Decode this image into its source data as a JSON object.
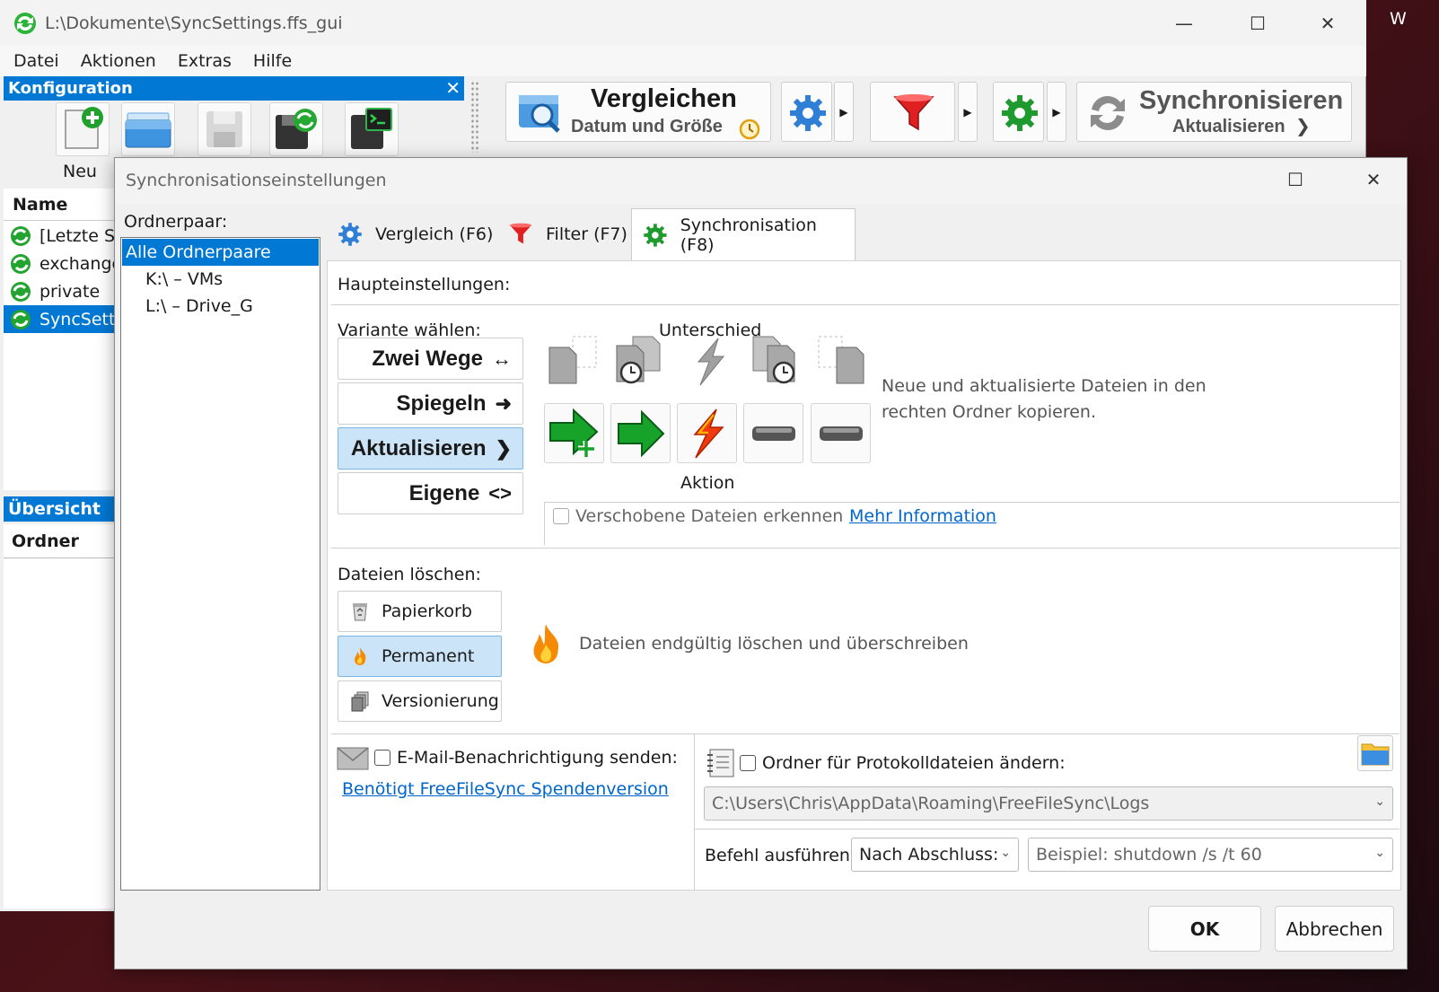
{
  "main_window": {
    "title": "L:\\Dokumente\\SyncSettings.ffs_gui",
    "menu": [
      "Datei",
      "Aktionen",
      "Extras",
      "Hilfe"
    ],
    "config_panel": {
      "header": "Konfiguration",
      "new_label": "Neu"
    },
    "toolbar": {
      "compare_title": "Vergleichen",
      "compare_sub": "Datum und Größe",
      "sync_title": "Synchronisieren",
      "sync_sub": "Aktualisieren"
    },
    "list_header": "Name",
    "list_items": [
      "[Letzte Si",
      "exchange",
      "private",
      "SyncSetti"
    ],
    "overview_header": "Übersicht",
    "folder_header": "Ordner",
    "edge_text": "W"
  },
  "dialog": {
    "title": "Synchronisationseinstellungen",
    "folder_pair_label": "Ordnerpaar:",
    "folder_pairs": [
      "Alle Ordnerpaare",
      "K:\\ – VMs",
      "L:\\ – Drive_G"
    ],
    "tabs": [
      "Vergleich (F6)",
      "Filter (F7)",
      "Synchronisation (F8)"
    ],
    "main_settings_label": "Haupteinstellungen:",
    "variant_label": "Variante wählen:",
    "variants": [
      {
        "label": "Zwei Wege",
        "symbol": "↔"
      },
      {
        "label": "Spiegeln",
        "symbol": "➜"
      },
      {
        "label": "Aktualisieren",
        "symbol": "❯"
      },
      {
        "label": "Eigene",
        "symbol": "<>"
      }
    ],
    "difference_label": "Unterschied",
    "action_label": "Aktion",
    "variant_description_1": "Neue und aktualisierte Dateien in den",
    "variant_description_2": "rechten Ordner kopieren.",
    "detect_moved_label": "Verschobene Dateien erkennen",
    "more_info_link": "Mehr Information",
    "delete_label": "Dateien löschen:",
    "delete_options": [
      "Papierkorb",
      "Permanent",
      "Versionierung"
    ],
    "delete_description": "Dateien endgültig löschen und überschreiben",
    "email_label": "E-Mail-Benachrichtigung senden:",
    "donation_link": "Benötigt FreeFileSync Spendenversion",
    "log_folder_label": "Ordner für Protokolldateien ändern:",
    "log_folder_path": "C:\\Users\\Chris\\AppData\\Roaming\\FreeFileSync\\Logs",
    "run_command_label": "Befehl ausführen:",
    "after_completion_value": "Nach Abschluss:",
    "command_placeholder": "Beispiel: shutdown /s /t 60",
    "ok_label": "OK",
    "cancel_label": "Abbrechen"
  },
  "colors": {
    "accent": "#0078d4",
    "selection": "#cce4f7",
    "link": "#0066cc",
    "green": "#1f9a2e",
    "red_filter": "#e02020"
  }
}
